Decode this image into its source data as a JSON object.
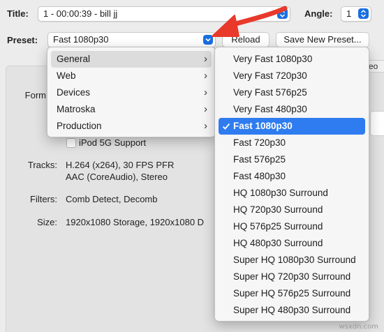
{
  "title_row": {
    "label": "Title:",
    "value": "1 - 00:00:39 - bill jj",
    "angle_label": "Angle:",
    "angle_value": "1"
  },
  "preset_row": {
    "label": "Preset:",
    "value": "Fast 1080p30",
    "reload_label": "Reload",
    "save_new_label": "Save New Preset..."
  },
  "tab_peek": "eo",
  "summary": {
    "format_label": "Form",
    "ipod_label": "iPod 5G Support",
    "tracks_label": "Tracks:",
    "tracks_line1": "H.264 (x264), 30 FPS PFR",
    "tracks_line2": "AAC (CoreAudio), Stereo",
    "filters_label": "Filters:",
    "filters_value": "Comb Detect, Decomb",
    "size_label": "Size:",
    "size_value": "1920x1080 Storage, 1920x1080 D"
  },
  "category_menu": {
    "items": [
      {
        "label": "General",
        "highlighted": true
      },
      {
        "label": "Web"
      },
      {
        "label": "Devices"
      },
      {
        "label": "Matroska"
      },
      {
        "label": "Production"
      }
    ],
    "chevron": "chevron-right-icon"
  },
  "preset_menu": {
    "selected": "Fast 1080p30",
    "items": [
      "Very Fast 1080p30",
      "Very Fast 720p30",
      "Very Fast 576p25",
      "Very Fast 480p30",
      "Fast 1080p30",
      "Fast 720p30",
      "Fast 576p25",
      "Fast 480p30",
      "HQ 1080p30 Surround",
      "HQ 720p30 Surround",
      "HQ 576p25 Surround",
      "HQ 480p30 Surround",
      "Super HQ 1080p30 Surround",
      "Super HQ 720p30 Surround",
      "Super HQ 576p25 Surround",
      "Super HQ 480p30 Surround"
    ]
  },
  "colors": {
    "accent": "#2e7cf0",
    "arrow": "#e8392b",
    "menu_bg": "#f6f6f6",
    "window_bg": "#ececec"
  },
  "watermark": "wsxdn.com"
}
